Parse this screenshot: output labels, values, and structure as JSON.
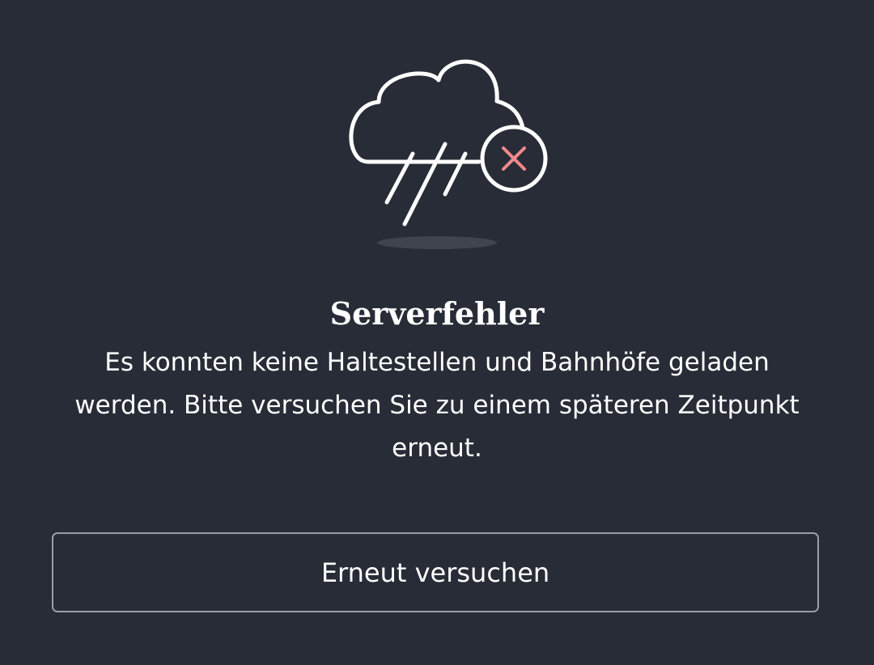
{
  "error": {
    "icon": "cloud-rain-error-icon",
    "title": "Serverfehler",
    "message": "Es konnten keine Haltestellen und Bahnhöfe geladen werden. Bitte versuchen Sie zu einem späteren Zeitpunkt erneut.",
    "retry_label": "Erneut versuchen"
  },
  "colors": {
    "background": "#282c37",
    "text": "#ffffff",
    "error_mark": "#f08a8a",
    "button_border": "#9a9ea8",
    "shadow": "#3f444f"
  }
}
